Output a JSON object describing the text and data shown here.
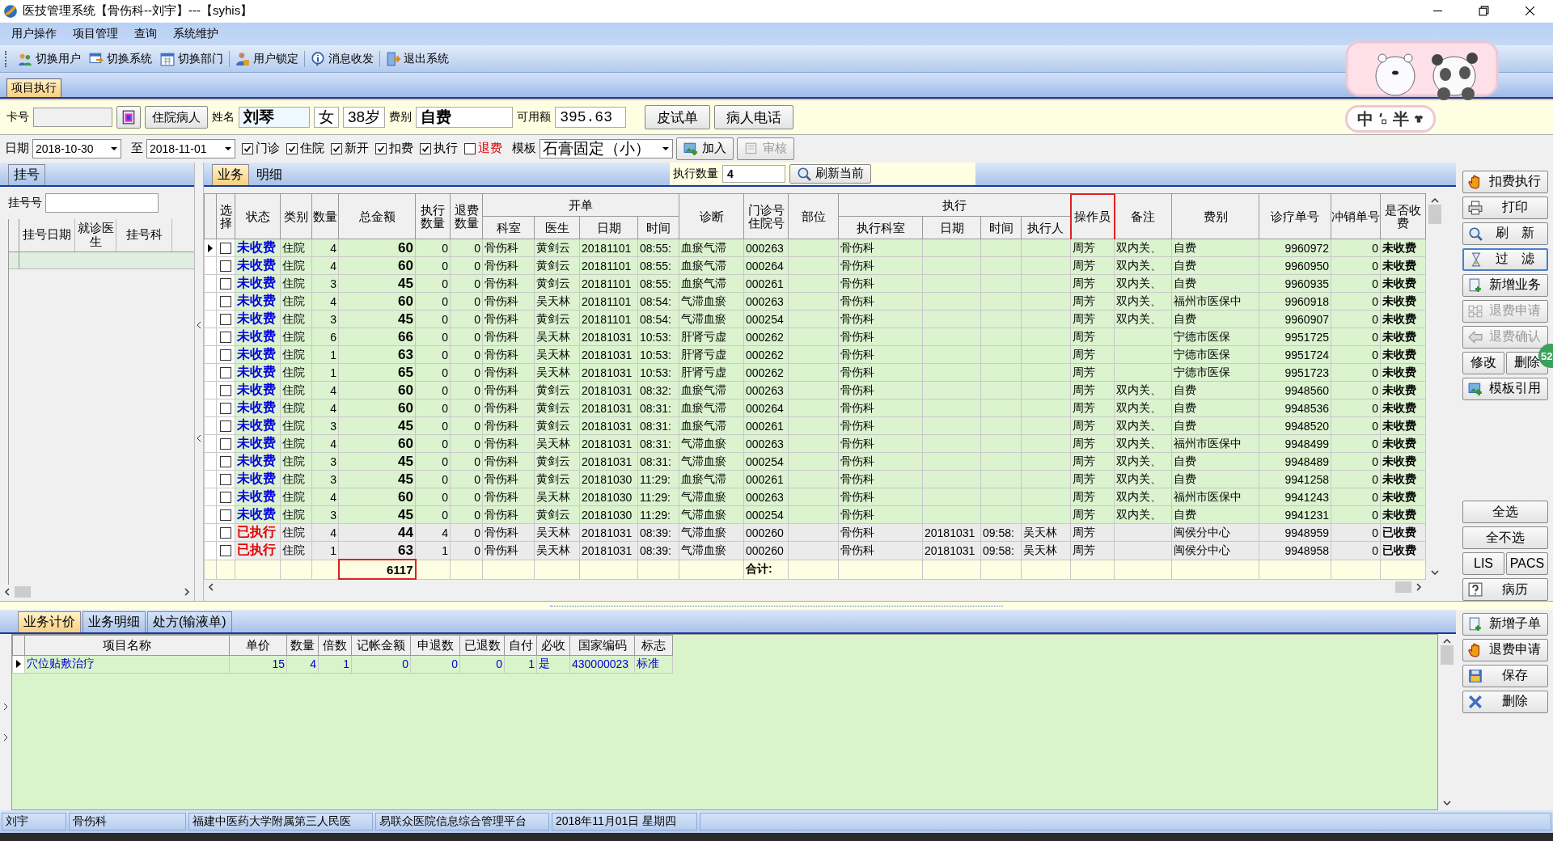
{
  "window": {
    "title": "医技管理系统【骨伤科--刘宇】---【syhis】"
  },
  "menu": [
    "用户操作",
    "项目管理",
    "查询",
    "系统维护"
  ],
  "toolbar": [
    "切换用户",
    "切换系统",
    "切换部门",
    "用户锁定",
    "消息收发",
    "退出系统"
  ],
  "doc_tabs": [
    {
      "label": "项目执行",
      "selected": true
    }
  ],
  "patient": {
    "card_label": "卡号",
    "type_button": "住院病人",
    "name_label": "姓名",
    "name": "刘琴",
    "sex": "女",
    "age": "38岁",
    "fee_type_label": "费别",
    "fee_type": "自费",
    "balance_label": "可用额",
    "balance": "395.63",
    "buttons": [
      "皮试单",
      "病人电话"
    ]
  },
  "filter": {
    "date_label": "日期",
    "date_from": "2018-10-30",
    "to_label": "至",
    "date_to": "2018-11-01",
    "checkboxes": [
      {
        "label": "门诊",
        "checked": true,
        "kind": "normal"
      },
      {
        "label": "住院",
        "checked": true,
        "kind": "normal"
      },
      {
        "label": "新开",
        "checked": true,
        "kind": "normal"
      },
      {
        "label": "扣费",
        "checked": true,
        "kind": "normal"
      },
      {
        "label": "执行",
        "checked": true,
        "kind": "normal"
      },
      {
        "label": "退费",
        "checked": false,
        "kind": "warning"
      }
    ],
    "template_label": "模板",
    "template": "石膏固定（小）",
    "buttons": [
      {
        "label": "加入",
        "disabled": false
      },
      {
        "label": "审核",
        "disabled": true
      }
    ]
  },
  "left_panel": {
    "tab": "挂号",
    "reg_label": "挂号号",
    "columns": [
      "挂号日期",
      "就诊医生",
      "挂号科"
    ]
  },
  "main_tabs": [
    {
      "label": "业务",
      "selected": true
    },
    {
      "label": "明细",
      "selected": false
    }
  ],
  "exec_count": {
    "label": "执行数量",
    "value": "4"
  },
  "refresh_button": "刷新当前",
  "table": {
    "select_label": "选择",
    "columns": [
      {
        "label": "状态"
      },
      {
        "label": "类别"
      },
      {
        "label": "数量"
      },
      {
        "label": "总金额"
      },
      {
        "label": "执行数量"
      },
      {
        "label": "退费数量"
      },
      {
        "label": "开单",
        "colspan": 4,
        "children": [
          {
            "label": "科室"
          },
          {
            "label": "医生"
          },
          {
            "label": "日期"
          },
          {
            "label": "时间"
          }
        ]
      },
      {
        "label": "诊断"
      },
      {
        "label": "门诊号住院号"
      },
      {
        "label": "部位"
      },
      {
        "label": "执行",
        "colspan": 4,
        "children": [
          {
            "label": "执行科室"
          },
          {
            "label": "日期"
          },
          {
            "label": "时间"
          },
          {
            "label": "执行人"
          }
        ]
      },
      {
        "label": "操作员",
        "highlighted": true
      },
      {
        "label": "备注"
      },
      {
        "label": "费别"
      },
      {
        "label": "诊疗单号"
      },
      {
        "label": "冲销单号"
      },
      {
        "label": "是否收费"
      }
    ],
    "rows": [
      {
        "selected": true,
        "checked": false,
        "kind": "unpaid",
        "cells": [
          "未收费",
          "住院",
          "4",
          "60",
          "0",
          "0",
          "骨伤科",
          "黄剑云",
          "20181101",
          "08:55:",
          "血瘀气滞",
          "000263",
          "",
          "骨伤科",
          "",
          "",
          "",
          "周芳",
          "双内关、",
          "自费",
          "9960972",
          "0",
          "未收费"
        ]
      },
      {
        "selected": false,
        "checked": false,
        "kind": "unpaid",
        "cells": [
          "未收费",
          "住院",
          "4",
          "60",
          "0",
          "0",
          "骨伤科",
          "黄剑云",
          "20181101",
          "08:55:",
          "血瘀气滞",
          "000264",
          "",
          "骨伤科",
          "",
          "",
          "",
          "周芳",
          "双内关、",
          "自费",
          "9960950",
          "0",
          "未收费"
        ]
      },
      {
        "selected": false,
        "checked": false,
        "kind": "unpaid",
        "cells": [
          "未收费",
          "住院",
          "3",
          "45",
          "0",
          "0",
          "骨伤科",
          "黄剑云",
          "20181101",
          "08:55:",
          "血瘀气滞",
          "000261",
          "",
          "骨伤科",
          "",
          "",
          "",
          "周芳",
          "双内关、",
          "自费",
          "9960935",
          "0",
          "未收费"
        ]
      },
      {
        "selected": false,
        "checked": false,
        "kind": "unpaid",
        "cells": [
          "未收费",
          "住院",
          "4",
          "60",
          "0",
          "0",
          "骨伤科",
          "吴天林",
          "20181101",
          "08:54:",
          "气滞血瘀",
          "000263",
          "",
          "骨伤科",
          "",
          "",
          "",
          "周芳",
          "双内关、",
          "福州市医保中",
          "9960918",
          "0",
          "未收费"
        ]
      },
      {
        "selected": false,
        "checked": false,
        "kind": "unpaid",
        "cells": [
          "未收费",
          "住院",
          "3",
          "45",
          "0",
          "0",
          "骨伤科",
          "黄剑云",
          "20181101",
          "08:54:",
          "气滞血瘀",
          "000254",
          "",
          "骨伤科",
          "",
          "",
          "",
          "周芳",
          "双内关、",
          "自费",
          "9960907",
          "0",
          "未收费"
        ]
      },
      {
        "selected": false,
        "checked": false,
        "kind": "unpaid",
        "cells": [
          "未收费",
          "住院",
          "6",
          "66",
          "0",
          "0",
          "骨伤科",
          "吴天林",
          "20181031",
          "10:53:",
          "肝肾亏虚",
          "000262",
          "",
          "骨伤科",
          "",
          "",
          "",
          "周芳",
          "",
          "宁德市医保",
          "9951725",
          "0",
          "未收费"
        ]
      },
      {
        "selected": false,
        "checked": false,
        "kind": "unpaid",
        "cells": [
          "未收费",
          "住院",
          "1",
          "63",
          "0",
          "0",
          "骨伤科",
          "吴天林",
          "20181031",
          "10:53:",
          "肝肾亏虚",
          "000262",
          "",
          "骨伤科",
          "",
          "",
          "",
          "周芳",
          "",
          "宁德市医保",
          "9951724",
          "0",
          "未收费"
        ]
      },
      {
        "selected": false,
        "checked": false,
        "kind": "unpaid",
        "cells": [
          "未收费",
          "住院",
          "1",
          "65",
          "0",
          "0",
          "骨伤科",
          "吴天林",
          "20181031",
          "10:53:",
          "肝肾亏虚",
          "000262",
          "",
          "骨伤科",
          "",
          "",
          "",
          "周芳",
          "",
          "宁德市医保",
          "9951723",
          "0",
          "未收费"
        ]
      },
      {
        "selected": false,
        "checked": false,
        "kind": "unpaid",
        "cells": [
          "未收费",
          "住院",
          "4",
          "60",
          "0",
          "0",
          "骨伤科",
          "黄剑云",
          "20181031",
          "08:32:",
          "血瘀气滞",
          "000263",
          "",
          "骨伤科",
          "",
          "",
          "",
          "周芳",
          "双内关、",
          "自费",
          "9948560",
          "0",
          "未收费"
        ]
      },
      {
        "selected": false,
        "checked": false,
        "kind": "unpaid",
        "cells": [
          "未收费",
          "住院",
          "4",
          "60",
          "0",
          "0",
          "骨伤科",
          "黄剑云",
          "20181031",
          "08:31:",
          "血瘀气滞",
          "000264",
          "",
          "骨伤科",
          "",
          "",
          "",
          "周芳",
          "双内关、",
          "自费",
          "9948536",
          "0",
          "未收费"
        ]
      },
      {
        "selected": false,
        "checked": false,
        "kind": "unpaid",
        "cells": [
          "未收费",
          "住院",
          "3",
          "45",
          "0",
          "0",
          "骨伤科",
          "黄剑云",
          "20181031",
          "08:31:",
          "血瘀气滞",
          "000261",
          "",
          "骨伤科",
          "",
          "",
          "",
          "周芳",
          "双内关、",
          "自费",
          "9948520",
          "0",
          "未收费"
        ]
      },
      {
        "selected": false,
        "checked": false,
        "kind": "unpaid",
        "cells": [
          "未收费",
          "住院",
          "4",
          "60",
          "0",
          "0",
          "骨伤科",
          "吴天林",
          "20181031",
          "08:31:",
          "气滞血瘀",
          "000263",
          "",
          "骨伤科",
          "",
          "",
          "",
          "周芳",
          "双内关、",
          "福州市医保中",
          "9948499",
          "0",
          "未收费"
        ]
      },
      {
        "selected": false,
        "checked": false,
        "kind": "unpaid",
        "cells": [
          "未收费",
          "住院",
          "3",
          "45",
          "0",
          "0",
          "骨伤科",
          "黄剑云",
          "20181031",
          "08:31:",
          "气滞血瘀",
          "000254",
          "",
          "骨伤科",
          "",
          "",
          "",
          "周芳",
          "双内关、",
          "自费",
          "9948489",
          "0",
          "未收费"
        ]
      },
      {
        "selected": false,
        "checked": false,
        "kind": "unpaid",
        "cells": [
          "未收费",
          "住院",
          "3",
          "45",
          "0",
          "0",
          "骨伤科",
          "黄剑云",
          "20181030",
          "11:29:",
          "血瘀气滞",
          "000261",
          "",
          "骨伤科",
          "",
          "",
          "",
          "周芳",
          "双内关、",
          "自费",
          "9941258",
          "0",
          "未收费"
        ]
      },
      {
        "selected": false,
        "checked": false,
        "kind": "unpaid",
        "cells": [
          "未收费",
          "住院",
          "4",
          "60",
          "0",
          "0",
          "骨伤科",
          "吴天林",
          "20181030",
          "11:29:",
          "气滞血瘀",
          "000263",
          "",
          "骨伤科",
          "",
          "",
          "",
          "周芳",
          "双内关、",
          "福州市医保中",
          "9941243",
          "0",
          "未收费"
        ]
      },
      {
        "selected": false,
        "checked": false,
        "kind": "unpaid",
        "cells": [
          "未收费",
          "住院",
          "3",
          "45",
          "0",
          "0",
          "骨伤科",
          "黄剑云",
          "20181030",
          "11:29:",
          "气滞血瘀",
          "000254",
          "",
          "骨伤科",
          "",
          "",
          "",
          "周芳",
          "双内关、",
          "自费",
          "9941231",
          "0",
          "未收费"
        ]
      },
      {
        "selected": false,
        "checked": false,
        "kind": "executed",
        "cells": [
          "已执行",
          "住院",
          "4",
          "44",
          "4",
          "0",
          "骨伤科",
          "吴天林",
          "20181031",
          "08:39:",
          "气滞血瘀",
          "000260",
          "",
          "骨伤科",
          "20181031",
          "09:58:",
          "吴天林",
          "周芳",
          "",
          "闽侯分中心",
          "9948959",
          "0",
          "已收费"
        ]
      },
      {
        "selected": false,
        "checked": false,
        "kind": "executed",
        "cells": [
          "已执行",
          "住院",
          "1",
          "63",
          "1",
          "0",
          "骨伤科",
          "吴天林",
          "20181031",
          "08:39:",
          "气滞血瘀",
          "000260",
          "",
          "骨伤科",
          "20181031",
          "09:58:",
          "吴天林",
          "周芳",
          "",
          "闽侯分中心",
          "9948958",
          "0",
          "已收费"
        ]
      }
    ],
    "footer": {
      "total": "6117",
      "total_highlighted": true,
      "label": "合计:"
    }
  },
  "side_buttons": [
    {
      "label": "扣费执行",
      "kind": "wide",
      "disabled": false,
      "focused": false
    },
    {
      "label": "打印",
      "kind": "wide",
      "disabled": false,
      "focused": false
    },
    {
      "label": "刷　新",
      "kind": "wide",
      "disabled": false,
      "focused": false
    },
    {
      "label": "过　滤",
      "kind": "wide",
      "disabled": false,
      "focused": true
    },
    {
      "label": "新增业务",
      "kind": "wide",
      "disabled": false,
      "focused": false
    },
    {
      "label": "退费申请",
      "kind": "wide",
      "disabled": true,
      "focused": false
    },
    {
      "label": "退费确认",
      "kind": "wide",
      "disabled": true,
      "focused": false
    },
    {
      "label": "修改",
      "kind": "half",
      "disabled": false,
      "focused": false
    },
    {
      "label": "删除",
      "kind": "half",
      "disabled": false,
      "focused": false
    },
    {
      "label": "模板引用",
      "kind": "wide",
      "disabled": false,
      "focused": false
    }
  ],
  "side_buttons_lower": [
    {
      "label": "全选",
      "kind": "wide"
    },
    {
      "label": "全不选",
      "kind": "wide"
    },
    {
      "label": "LIS",
      "kind": "half"
    },
    {
      "label": "PACS",
      "kind": "half"
    },
    {
      "label": "病历",
      "kind": "wide"
    }
  ],
  "detail_tabs": [
    {
      "label": "业务计价",
      "selected": true
    },
    {
      "label": "业务明细",
      "selected": false
    },
    {
      "label": "处方(输液单)",
      "selected": false
    }
  ],
  "detail_table": {
    "columns": [
      "项目名称",
      "单价",
      "数量",
      "倍数",
      "记帐金额",
      "申退数",
      "已退数",
      "自付",
      "必收",
      "国家编码",
      "标志"
    ],
    "rows": [
      {
        "selected": true,
        "cells": [
          "穴位贴敷治疗",
          "15",
          "4",
          "1",
          "0",
          "0",
          "0",
          "1",
          "是",
          "430000023",
          "标准"
        ]
      }
    ]
  },
  "detail_buttons": [
    "新增子单",
    "退费申请",
    "保存",
    "删除"
  ],
  "status_bar": [
    "刘宇",
    "骨伤科",
    "福建中医药大学附属第三人民医",
    "易联众医院信息综合管理平台",
    "2018年11月01日  星期四"
  ],
  "ime_widget": {
    "mode": "中",
    "width": "半"
  },
  "floating_badge": "52"
}
